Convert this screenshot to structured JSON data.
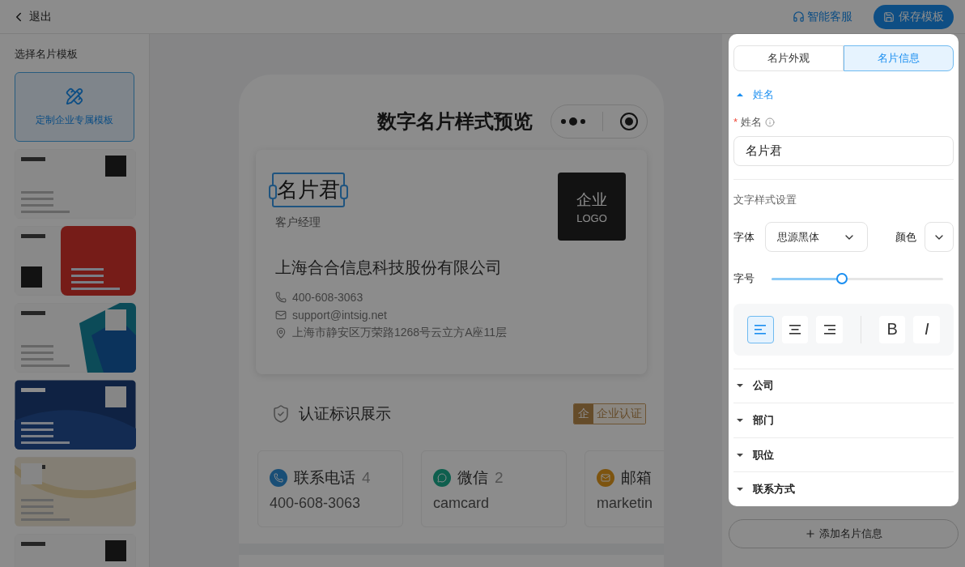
{
  "top_bar": {
    "back": "退出",
    "service": "智能客服",
    "save": "保存模板"
  },
  "sidebar": {
    "title": "选择名片模板",
    "custom": "定制企业专属模板",
    "templates": [
      {
        "kind": "light"
      },
      {
        "kind": "red"
      },
      {
        "kind": "teal"
      },
      {
        "kind": "navy"
      },
      {
        "kind": "gold"
      },
      {
        "kind": "light-dark"
      }
    ]
  },
  "preview": {
    "title": "数字名片样式预览",
    "card": {
      "name": "名片君",
      "name_selected": true,
      "position": "客户经理",
      "logo_lines": [
        "企业",
        "LOGO"
      ],
      "company": "上海合合信息科技股份有限公司",
      "contacts": [
        {
          "kind": "phone",
          "text": "400-608-3063"
        },
        {
          "kind": "email",
          "text": "support@intsig.net"
        },
        {
          "kind": "address",
          "text": "上海市静安区万荣路1268号云立方A座11层"
        }
      ]
    },
    "certification": {
      "title": "认证标识展示",
      "badge_mark": "企",
      "badge": "企业认证"
    },
    "contact_cards": [
      {
        "kind": "phone",
        "title": "联系电话",
        "count": "4",
        "value": "400-608-3063"
      },
      {
        "kind": "wechat",
        "title": "微信",
        "count": "2",
        "value": "camcard"
      },
      {
        "kind": "email",
        "title": "邮箱",
        "value": "marketin"
      }
    ]
  },
  "panel": {
    "tabs": [
      {
        "label": "名片外观",
        "selected": false
      },
      {
        "label": "名片信息",
        "selected": true
      }
    ],
    "name_section": {
      "title": "姓名",
      "expanded": true,
      "field": {
        "required_mark": "*",
        "label": "姓名",
        "value": "名片君"
      },
      "style_title": "文字样式设置",
      "font": {
        "label": "字体",
        "value": "思源黑体"
      },
      "color": {
        "label": "颜色"
      },
      "size": {
        "label": "字号",
        "level": 0.41
      },
      "format": [
        {
          "kind": "align-left",
          "selected": true
        },
        {
          "kind": "align-center",
          "selected": false
        },
        {
          "kind": "align-right",
          "selected": false
        },
        {
          "kind": "bold",
          "label": "B",
          "selected": false
        },
        {
          "kind": "italic",
          "label": "I",
          "selected": false
        }
      ]
    },
    "sections": [
      {
        "title": "公司",
        "expanded": false
      },
      {
        "title": "部门",
        "expanded": false
      },
      {
        "title": "职位",
        "expanded": false
      },
      {
        "title": "联系方式",
        "expanded": false
      }
    ]
  },
  "add_button": "添加名片信息"
}
